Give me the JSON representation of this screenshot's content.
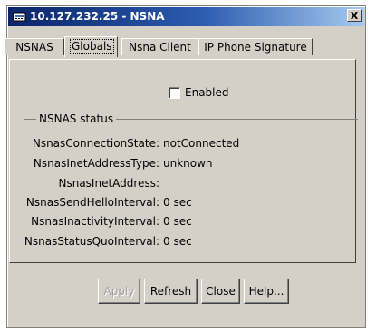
{
  "window": {
    "title": "10.127.232.25 - NSNA",
    "close_label": "X"
  },
  "tabs": [
    {
      "label": "NSNAS"
    },
    {
      "label": "Globals",
      "active": true
    },
    {
      "label": "Nsna Client"
    },
    {
      "label": "IP Phone Signature"
    }
  ],
  "globals": {
    "enabled_label": "Enabled",
    "enabled_checked": false,
    "group_title": "NSNAS status",
    "fields": [
      {
        "label": "NsnasConnectionState:",
        "value": "notConnected"
      },
      {
        "label": "NsnasInetAddressType:",
        "value": "unknown"
      },
      {
        "label": "NsnasInetAddress:",
        "value": ""
      },
      {
        "label": "NsnasSendHelloInterval:",
        "value": "0 sec"
      },
      {
        "label": "NsnasInactivityInterval:",
        "value": "0 sec"
      },
      {
        "label": "NsnasStatusQuoInterval:",
        "value": "0 sec"
      }
    ]
  },
  "buttons": {
    "apply": "Apply",
    "refresh": "Refresh",
    "close": "Close",
    "help": "Help..."
  }
}
